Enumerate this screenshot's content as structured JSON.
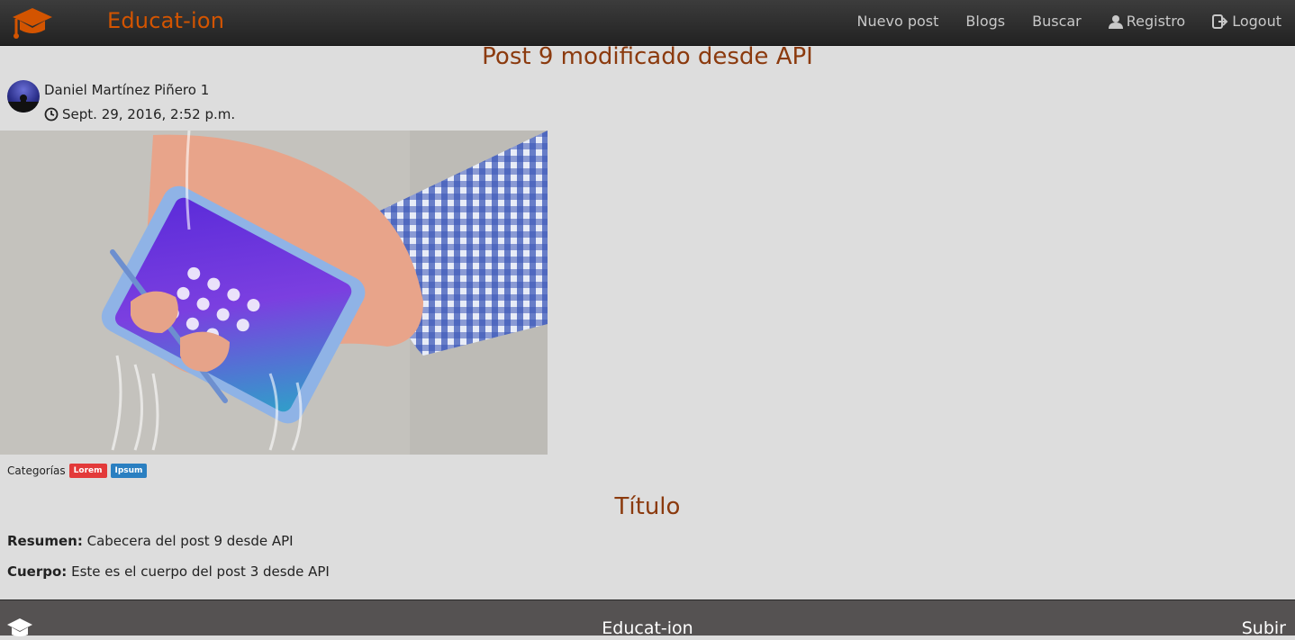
{
  "navbar": {
    "brand": "Educat-ion",
    "brand_color": "#d35400",
    "links": [
      {
        "label": "Nuevo post",
        "icon": ""
      },
      {
        "label": "Blogs",
        "icon": ""
      },
      {
        "label": "Buscar",
        "icon": ""
      },
      {
        "label": "Registro",
        "icon": "user-icon"
      },
      {
        "label": "Logout",
        "icon": "logout-icon"
      }
    ]
  },
  "post": {
    "title": "Post 9 modificado desde API",
    "author": "Daniel Martínez Piñero 1",
    "date": "Sept. 29, 2016, 2:52 p.m.",
    "image_alt": "phone-under-water-image",
    "categories_label": "Categorías",
    "categories": [
      {
        "label": "Lorem",
        "color": "#e33a3a"
      },
      {
        "label": "Ipsum",
        "color": "#2a7fc1"
      }
    ],
    "section_title": "Título",
    "summary_label": "Resumen:",
    "summary": "Cabecera del post 9 desde API",
    "body_label": "Cuerpo:",
    "body": "Este es el cuerpo del post 3 desde API"
  },
  "footer": {
    "brand": "Educat-ion",
    "up_label": "Subir"
  },
  "colors": {
    "accent": "#d35400",
    "title": "#8b3a0e",
    "background": "#dddddd"
  }
}
